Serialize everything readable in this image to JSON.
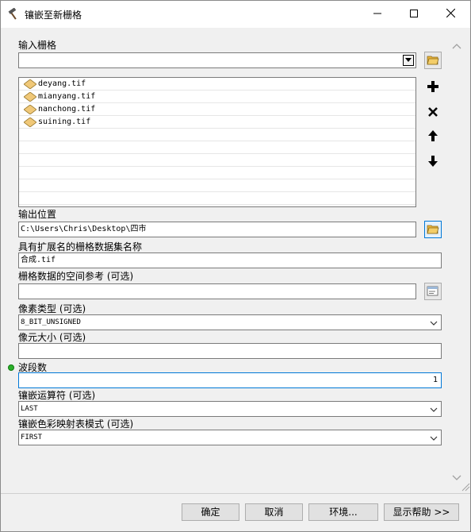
{
  "window": {
    "title": "镶嵌至新栅格",
    "title_icon": "hammer-icon",
    "min_icon": "minimize-icon",
    "max_icon": "maximize-icon",
    "close_icon": "close-icon"
  },
  "input_rasters": {
    "label": "输入栅格",
    "combo_value": "",
    "browse_icon": "folder-icon",
    "items": [
      {
        "name": "deyang.tif"
      },
      {
        "name": "mianyang.tif"
      },
      {
        "name": "nanchong.tif"
      },
      {
        "name": "suining.tif"
      }
    ],
    "item_icon": "raster-icon",
    "list_buttons": [
      "add-icon",
      "remove-icon",
      "up-arrow-icon",
      "down-arrow-icon"
    ]
  },
  "output_location": {
    "label": "输出位置",
    "value": "C:\\Users\\Chris\\Desktop\\四市"
  },
  "dataset_name": {
    "label": "具有扩展名的栅格数据集名称",
    "value": "合成.tif"
  },
  "spatial_reference": {
    "label": "栅格数据的空间参考 (可选)",
    "value": ""
  },
  "pixel_type": {
    "label": "像素类型 (可选)",
    "value": "8_BIT_UNSIGNED"
  },
  "cell_size": {
    "label": "像元大小 (可选)",
    "value": ""
  },
  "band_count": {
    "label": "波段数",
    "value": "1",
    "required_color": "#2bb02b"
  },
  "mosaic_operator": {
    "label": "镶嵌运算符 (可选)",
    "value": "LAST"
  },
  "colormap_mode": {
    "label": "镶嵌色彩映射表模式 (可选)",
    "value": "FIRST"
  },
  "buttons": {
    "ok": "确定",
    "cancel": "取消",
    "environments": "环境...",
    "help": "显示帮助 >>"
  },
  "colors": {
    "accent": "#0078d7",
    "folder": "#e8b33a"
  }
}
